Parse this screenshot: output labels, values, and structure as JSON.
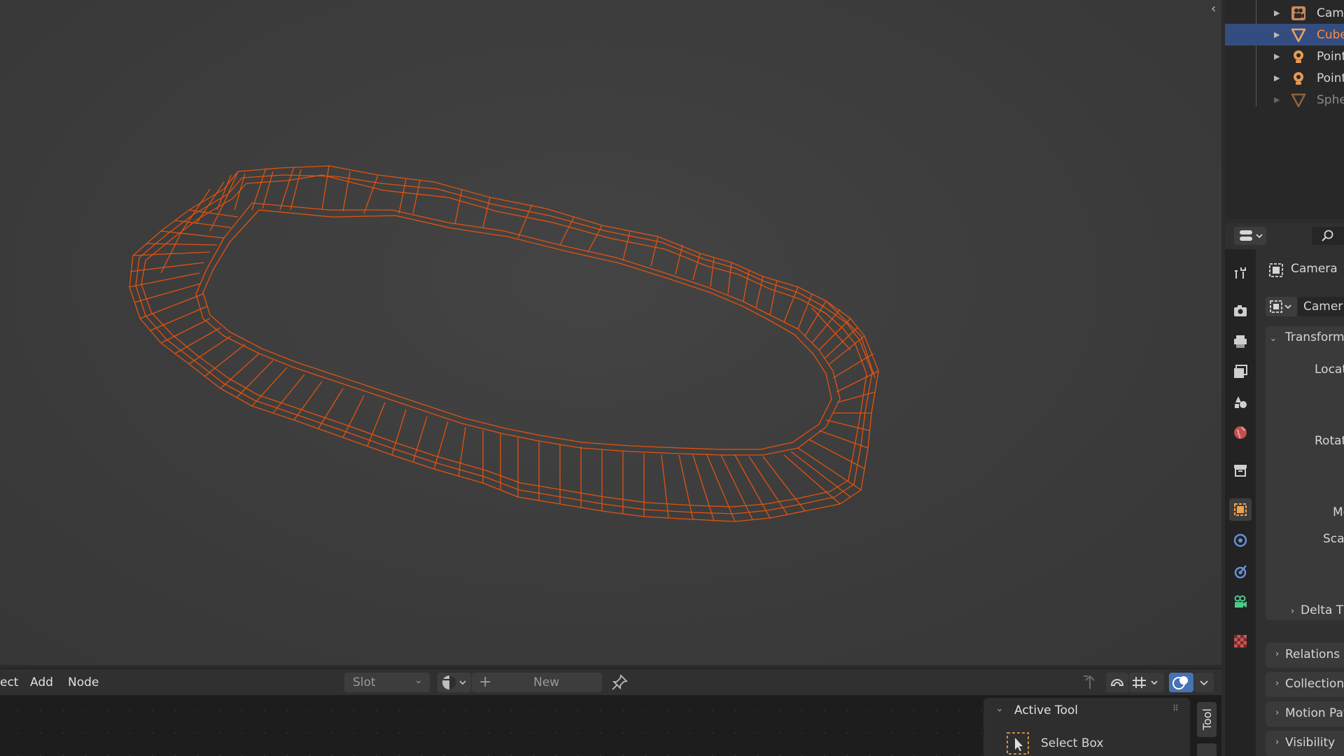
{
  "outliner": {
    "items": [
      {
        "label": "Cam",
        "icon": "camera-object-icon",
        "selected": false,
        "dim": false
      },
      {
        "label": "Cube",
        "icon": "mesh-object-icon",
        "selected": true,
        "dim": false
      },
      {
        "label": "Point",
        "icon": "light-object-icon",
        "selected": false,
        "dim": false
      },
      {
        "label": "Point",
        "icon": "light-object-icon",
        "selected": false,
        "dim": false
      },
      {
        "label": "Sphe",
        "icon": "mesh-object-icon",
        "selected": false,
        "dim": true
      }
    ]
  },
  "properties": {
    "object_name": "Camera",
    "datablock_name": "Camer",
    "transform_label": "Transform",
    "location_label": "Location",
    "rotation_label": "Rotation",
    "mode_label": "Moc",
    "scale_label": "Scale",
    "delta_label": "Delta T",
    "sections": [
      "Relations",
      "Collection",
      "Motion Pat",
      "Visibility"
    ]
  },
  "node_editor": {
    "menu": [
      "ect",
      "Add",
      "Node"
    ],
    "slot_label": "Slot",
    "new_label": "New",
    "active_tool_title": "Active Tool",
    "select_box_label": "Select Box",
    "tool_tab_label": "Tool"
  },
  "colors": {
    "wire": "#e8500f",
    "selected_text": "#ff8c3a",
    "selection_bg": "#334d80"
  }
}
